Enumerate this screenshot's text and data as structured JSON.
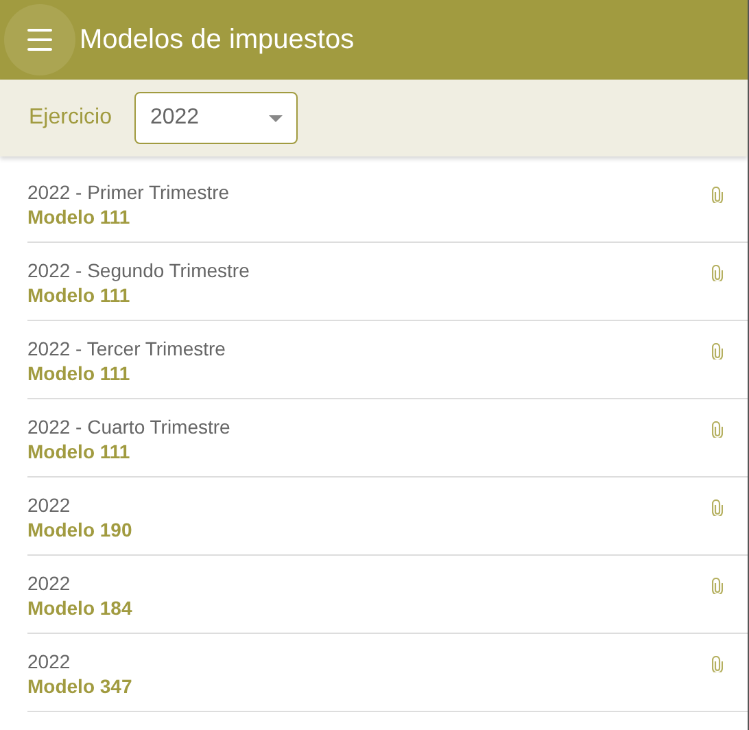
{
  "app_bar": {
    "title": "Modelos de impuestos"
  },
  "filter": {
    "label": "Ejercicio",
    "value": "2022"
  },
  "items": [
    {
      "period": "2022 - Primer Trimestre",
      "model": "Modelo 111"
    },
    {
      "period": "2022 - Segundo Trimestre",
      "model": "Modelo 111"
    },
    {
      "period": "2022 - Tercer Trimestre",
      "model": "Modelo 111"
    },
    {
      "period": "2022 - Cuarto Trimestre",
      "model": "Modelo 111"
    },
    {
      "period": "2022",
      "model": "Modelo 190"
    },
    {
      "period": "2022",
      "model": "Modelo 184"
    },
    {
      "period": "2022",
      "model": "Modelo 347"
    }
  ]
}
